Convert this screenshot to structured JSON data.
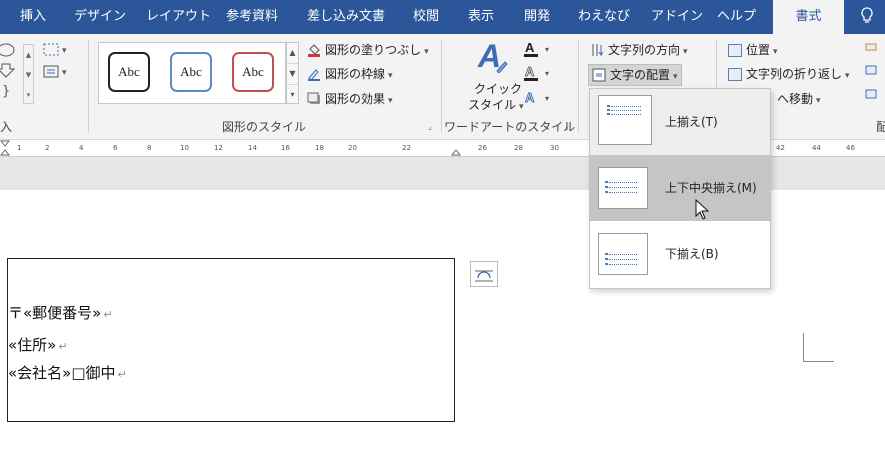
{
  "tabs": [
    {
      "label": "挿入",
      "active": false
    },
    {
      "label": "デザイン",
      "active": false
    },
    {
      "label": "レイアウト",
      "active": false
    },
    {
      "label": "参考資料",
      "active": false
    },
    {
      "label": "差し込み文書",
      "active": false
    },
    {
      "label": "校閲",
      "active": false
    },
    {
      "label": "表示",
      "active": false
    },
    {
      "label": "開発",
      "active": false
    },
    {
      "label": "わえなび",
      "active": false
    },
    {
      "label": "アドイン",
      "active": false
    },
    {
      "label": "ヘルプ",
      "active": false
    },
    {
      "label": "書式",
      "active": true
    }
  ],
  "ribbon": {
    "left_group_label": "入",
    "shape_styles": {
      "gallery": [
        {
          "label": "Abc",
          "border_color": "#222222"
        },
        {
          "label": "Abc",
          "border_color": "#5b8bc9"
        },
        {
          "label": "Abc",
          "border_color": "#c0504d"
        }
      ],
      "fill_label": "図形の塗りつぶし",
      "outline_label": "図形の枠線",
      "effects_label": "図形の効果",
      "group_label": "図形のスタイル"
    },
    "wordart": {
      "quick_styles_line1": "クイック",
      "quick_styles_line2": "スタイル",
      "group_label": "ワードアートのスタイル"
    },
    "text": {
      "direction_label": "文字列の方向",
      "align_label": "文字の配置"
    },
    "arrange": {
      "position_label": "位置",
      "wrap_label": "文字列の折り返し",
      "forward_label": "へ移動",
      "group_label_partial": "配"
    }
  },
  "ruler": {
    "ticks": [
      "1",
      "2",
      "4",
      "6",
      "8",
      "10",
      "12",
      "14",
      "16",
      "18",
      "20",
      "22",
      "26",
      "28",
      "30",
      "42",
      "44",
      "46"
    ]
  },
  "document": {
    "lines": [
      "〒«郵便番号»",
      "«住所»",
      "«会社名»□御中"
    ]
  },
  "dropdown": {
    "items": [
      {
        "label": "上揃え(T)",
        "state": "selected"
      },
      {
        "label": "上下中央揃え(M)",
        "state": "hover"
      },
      {
        "label": "下揃え(B)",
        "state": "normal"
      }
    ]
  },
  "colors": {
    "tab_bar": "#2b579a",
    "ribbon_bg": "#f3f3f3",
    "menu_hover": "#c5c5c5",
    "fill_red": "#d13438",
    "wordart_blue": "#3e6cb5"
  }
}
